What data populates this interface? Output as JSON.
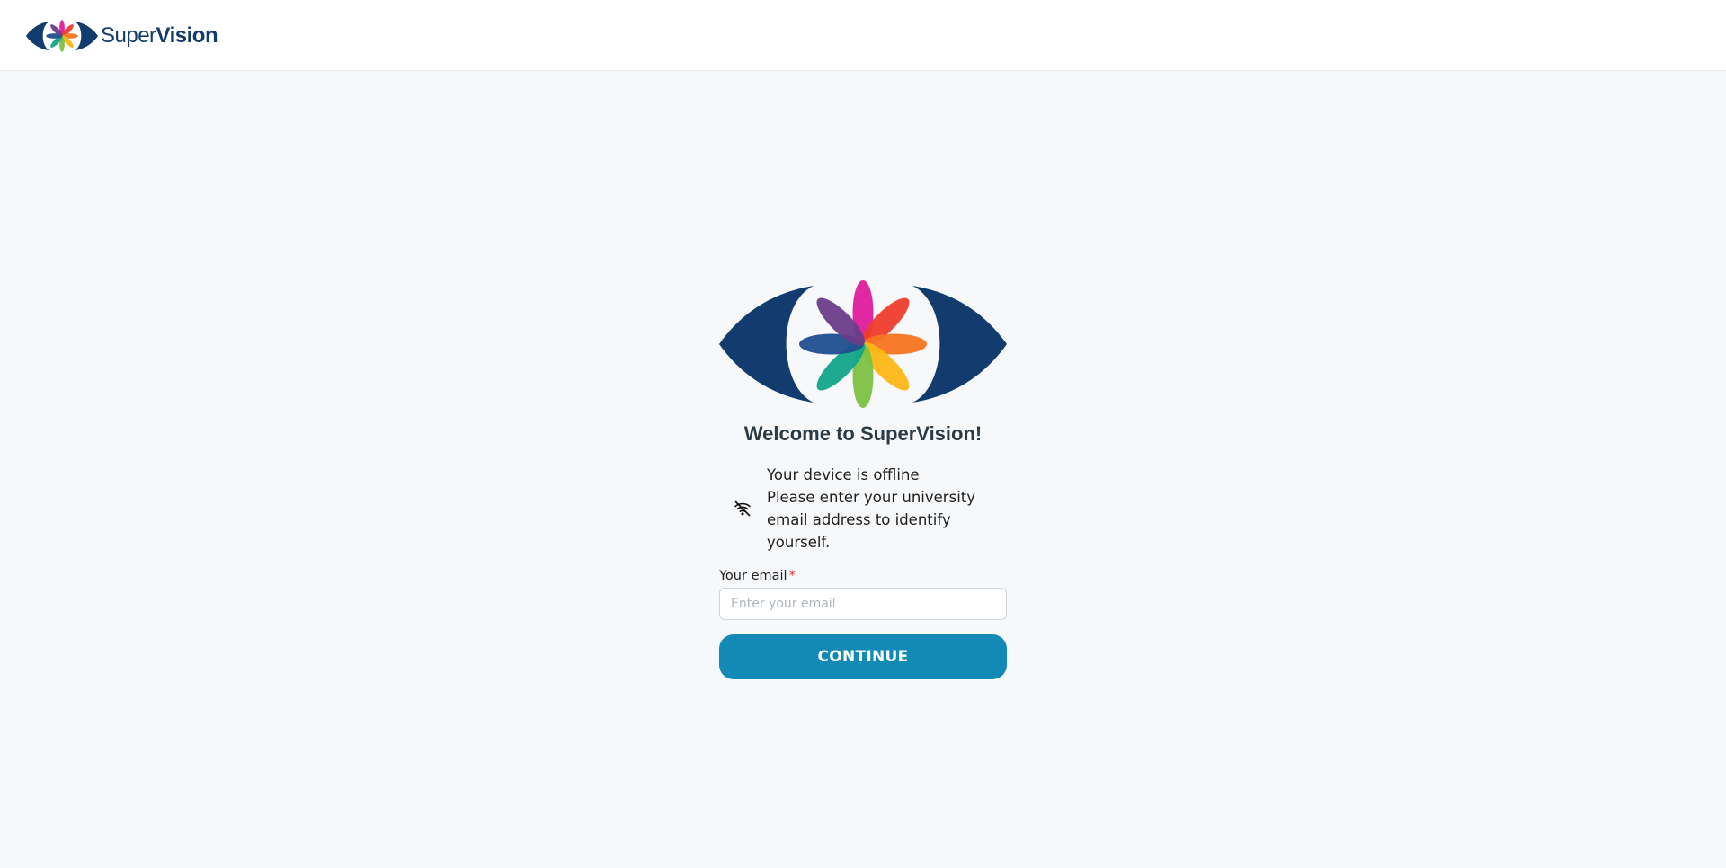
{
  "header": {
    "brand_light": "Super",
    "brand_bold": "Vision",
    "logo_icon": "supervision-eye-logo"
  },
  "main": {
    "welcome_title": "Welcome to SuperVision!",
    "offline_icon": "wifi-off-icon",
    "offline_status": "Your device is offline",
    "offline_instruction": "Please enter your university email address to identify yourself.",
    "email_label": "Your email",
    "email_required_mark": "*",
    "email_placeholder": "Enter your email",
    "email_value": "",
    "continue_label": "CONTINUE"
  },
  "colors": {
    "brand_navy": "#123c6e",
    "button": "#128ab5",
    "background": "#f7f8fa",
    "required": "#e03131",
    "petals": [
      "#e01c9b",
      "#ef3c2d",
      "#f57420",
      "#fcb716",
      "#7cc242",
      "#12a58b",
      "#1f4f8f",
      "#6a3d8a"
    ]
  }
}
